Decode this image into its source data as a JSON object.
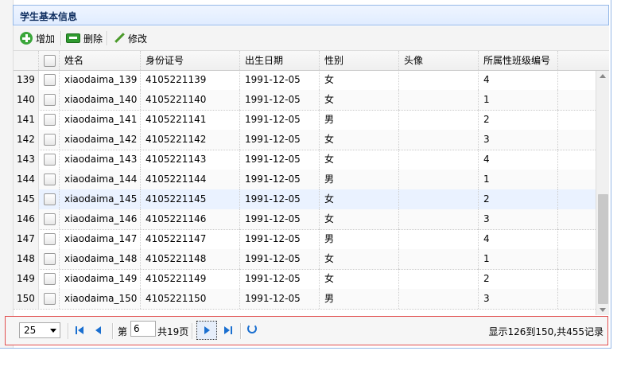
{
  "panel": {
    "title": "学生基本信息"
  },
  "toolbar": {
    "add_label": "增加",
    "remove_label": "删除",
    "edit_label": "修改"
  },
  "columns": [
    "姓名",
    "身份证号",
    "出生日期",
    "性别",
    "头像",
    "所属性班级编号"
  ],
  "rows": [
    {
      "rownum": "139",
      "name": "xiaodaima_139",
      "id": "4105221139",
      "birth": "1991-12-05",
      "gender": "女",
      "avatar": "",
      "class": "4"
    },
    {
      "rownum": "140",
      "name": "xiaodaima_140",
      "id": "4105221140",
      "birth": "1991-12-05",
      "gender": "女",
      "avatar": "",
      "class": "1"
    },
    {
      "rownum": "141",
      "name": "xiaodaima_141",
      "id": "4105221141",
      "birth": "1991-12-05",
      "gender": "男",
      "avatar": "",
      "class": "2"
    },
    {
      "rownum": "142",
      "name": "xiaodaima_142",
      "id": "4105221142",
      "birth": "1991-12-05",
      "gender": "女",
      "avatar": "",
      "class": "3"
    },
    {
      "rownum": "143",
      "name": "xiaodaima_143",
      "id": "4105221143",
      "birth": "1991-12-05",
      "gender": "女",
      "avatar": "",
      "class": "4"
    },
    {
      "rownum": "144",
      "name": "xiaodaima_144",
      "id": "4105221144",
      "birth": "1991-12-05",
      "gender": "男",
      "avatar": "",
      "class": "1"
    },
    {
      "rownum": "145",
      "name": "xiaodaima_145",
      "id": "4105221145",
      "birth": "1991-12-05",
      "gender": "女",
      "avatar": "",
      "class": "2"
    },
    {
      "rownum": "146",
      "name": "xiaodaima_146",
      "id": "4105221146",
      "birth": "1991-12-05",
      "gender": "女",
      "avatar": "",
      "class": "3"
    },
    {
      "rownum": "147",
      "name": "xiaodaima_147",
      "id": "4105221147",
      "birth": "1991-12-05",
      "gender": "男",
      "avatar": "",
      "class": "4"
    },
    {
      "rownum": "148",
      "name": "xiaodaima_148",
      "id": "4105221148",
      "birth": "1991-12-05",
      "gender": "女",
      "avatar": "",
      "class": "1"
    },
    {
      "rownum": "149",
      "name": "xiaodaima_149",
      "id": "4105221149",
      "birth": "1991-12-05",
      "gender": "女",
      "avatar": "",
      "class": "2"
    },
    {
      "rownum": "150",
      "name": "xiaodaima_150",
      "id": "4105221150",
      "birth": "1991-12-05",
      "gender": "男",
      "avatar": "",
      "class": "3"
    }
  ],
  "selected_row": "145",
  "pager": {
    "page_size": "25",
    "page_prefix": "第",
    "current_page": "6",
    "page_total": "共19页",
    "info": "显示126到150,共455记录"
  },
  "colors": {
    "header_border": "#95b8e7",
    "title": "#0e2d5f",
    "pager_highlight": "#e25050",
    "icon_blue": "#1a6fd0"
  }
}
